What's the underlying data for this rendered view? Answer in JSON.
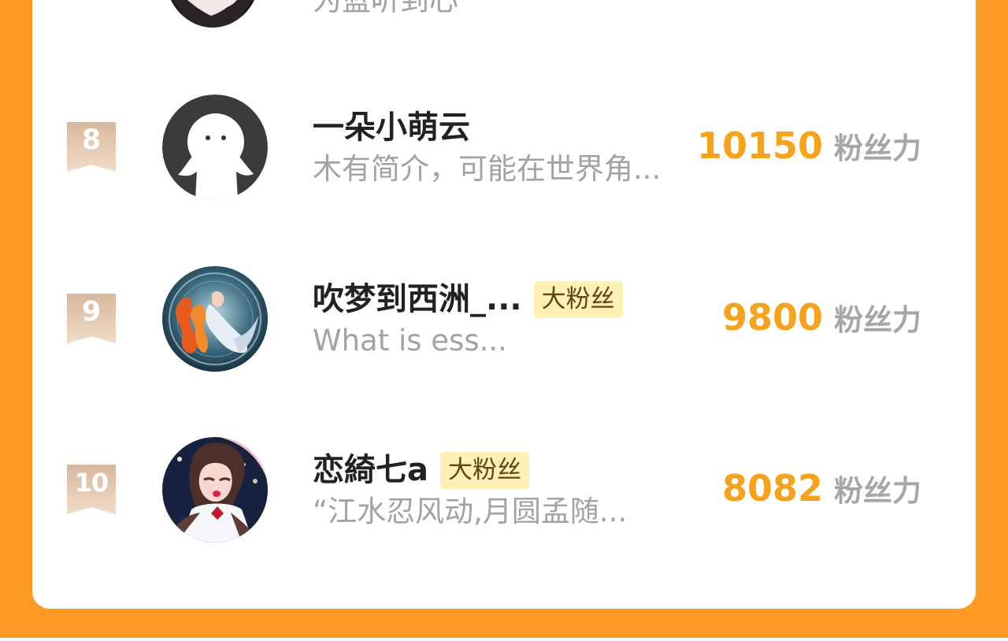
{
  "previous_item": {
    "bio": "为蓝听到心"
  },
  "ranking": [
    {
      "rank": "8",
      "name": "一朵小萌云",
      "tag": "",
      "bio": "木有简介，可能在世界角...",
      "score": "10150",
      "score_label": "粉丝力"
    },
    {
      "rank": "9",
      "name": "吹梦到西洲_...",
      "tag": "大粉丝",
      "bio": "What is ess...",
      "score": "9800",
      "score_label": "粉丝力"
    },
    {
      "rank": "10",
      "name": "恋綺七a",
      "tag": "大粉丝",
      "bio": "“江水忍风动,月圆孟随...",
      "score": "8082",
      "score_label": "粉丝力"
    }
  ],
  "colors": {
    "frame": "#ff9a24",
    "score": "#f7a21b",
    "tag_background": "#fff0b5",
    "rank_badge": "#d7b79d"
  },
  "icons": [
    "rank-ribbon-icon",
    "default-avatar-icon"
  ]
}
